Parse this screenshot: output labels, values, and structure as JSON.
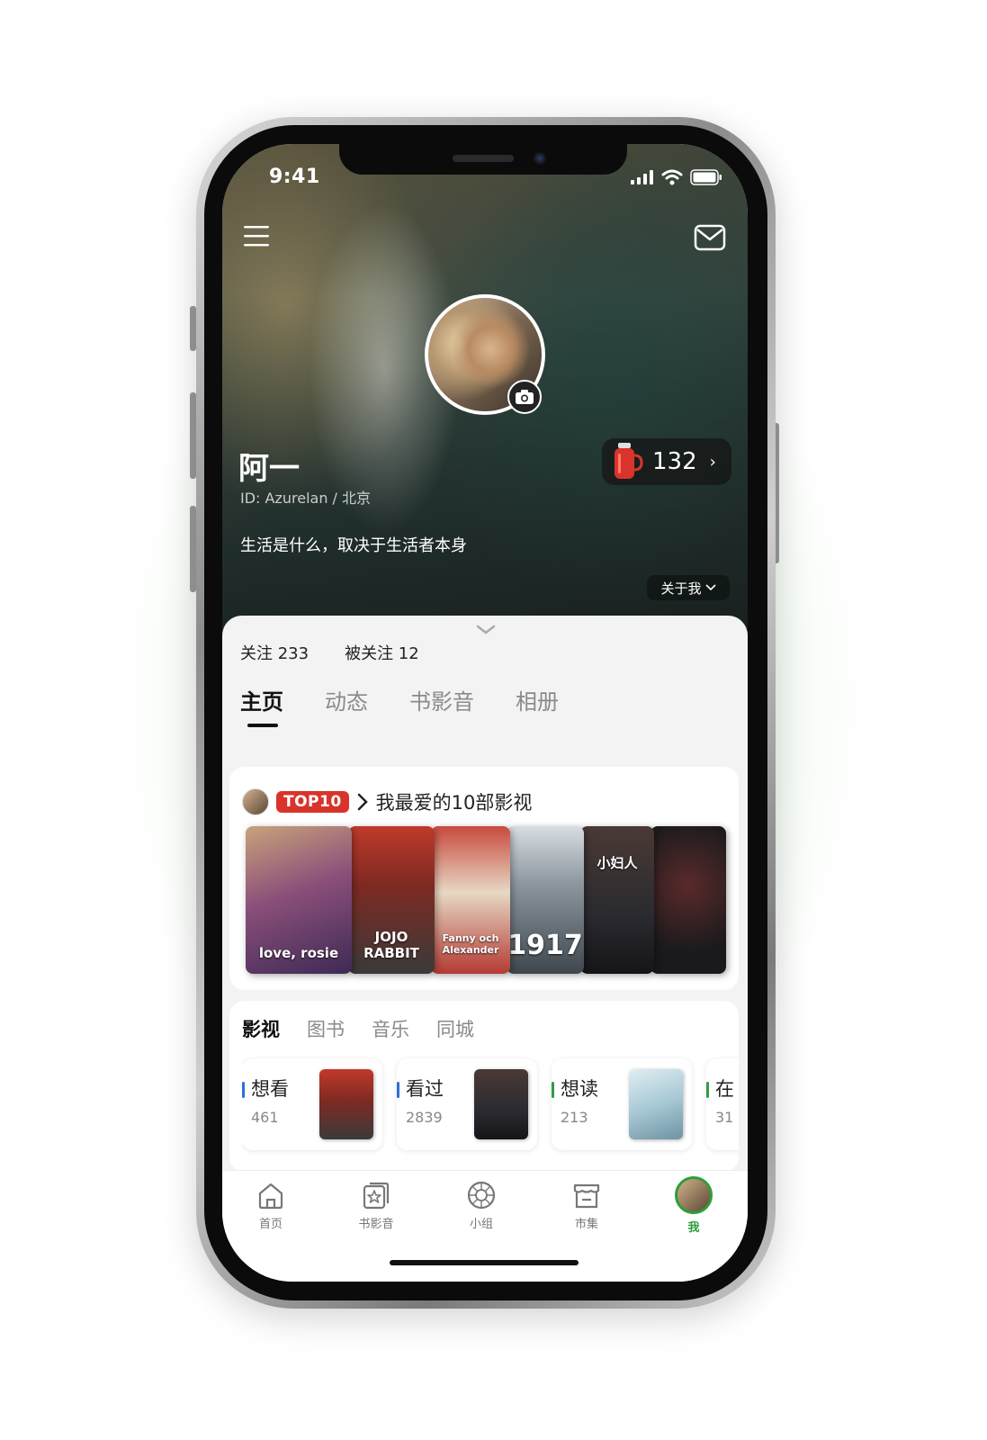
{
  "status_bar": {
    "time": "9:41"
  },
  "profile": {
    "name": "阿一",
    "id_line": "ID: Azurelan / 北京",
    "bio": "生活是什么，取决于生活者本身",
    "score": "132",
    "about_label": "关于我",
    "following": "关注 233",
    "followers": "被关注 12"
  },
  "tabs": [
    {
      "label": "主页",
      "active": true
    },
    {
      "label": "动态"
    },
    {
      "label": "书影音"
    },
    {
      "label": "相册"
    }
  ],
  "top10": {
    "badge": "TOP10",
    "title": "我最爱的10部影视",
    "posters": [
      {
        "label": "love, rosie",
        "color": "#6b4b78"
      },
      {
        "label": "JOJO RABBIT",
        "color": "#a3362e"
      },
      {
        "label": "Fanny och Alexander",
        "color": "#b43a34"
      },
      {
        "label": "1917",
        "color": "#5c6770"
      },
      {
        "label": "小妇人",
        "color": "#2a2a30"
      },
      {
        "label": "",
        "color": "#1a1a1c"
      }
    ]
  },
  "media": {
    "tabs": [
      {
        "label": "影视",
        "active": true
      },
      {
        "label": "图书"
      },
      {
        "label": "音乐"
      },
      {
        "label": "同城"
      }
    ],
    "shelf": [
      {
        "title": "想看",
        "count": "461",
        "bar_color": "#2f6fd6",
        "thumb_color": "#a83a30"
      },
      {
        "title": "看过",
        "count": "2839",
        "bar_color": "#2f6fd6",
        "thumb_color": "#2a2a30"
      },
      {
        "title": "想读",
        "count": "213",
        "bar_color": "#2e9e3a",
        "thumb_color": "#a9c9d6"
      },
      {
        "title": "在",
        "count": "31",
        "bar_color": "#2e9e3a",
        "thumb_color": "#cccccc"
      }
    ]
  },
  "tabbar": [
    {
      "label": "首页",
      "icon": "home-icon"
    },
    {
      "label": "书影音",
      "icon": "star-card-icon"
    },
    {
      "label": "小组",
      "icon": "group-icon"
    },
    {
      "label": "市集",
      "icon": "store-icon"
    },
    {
      "label": "我",
      "icon": "me-avatar",
      "active": true
    }
  ]
}
